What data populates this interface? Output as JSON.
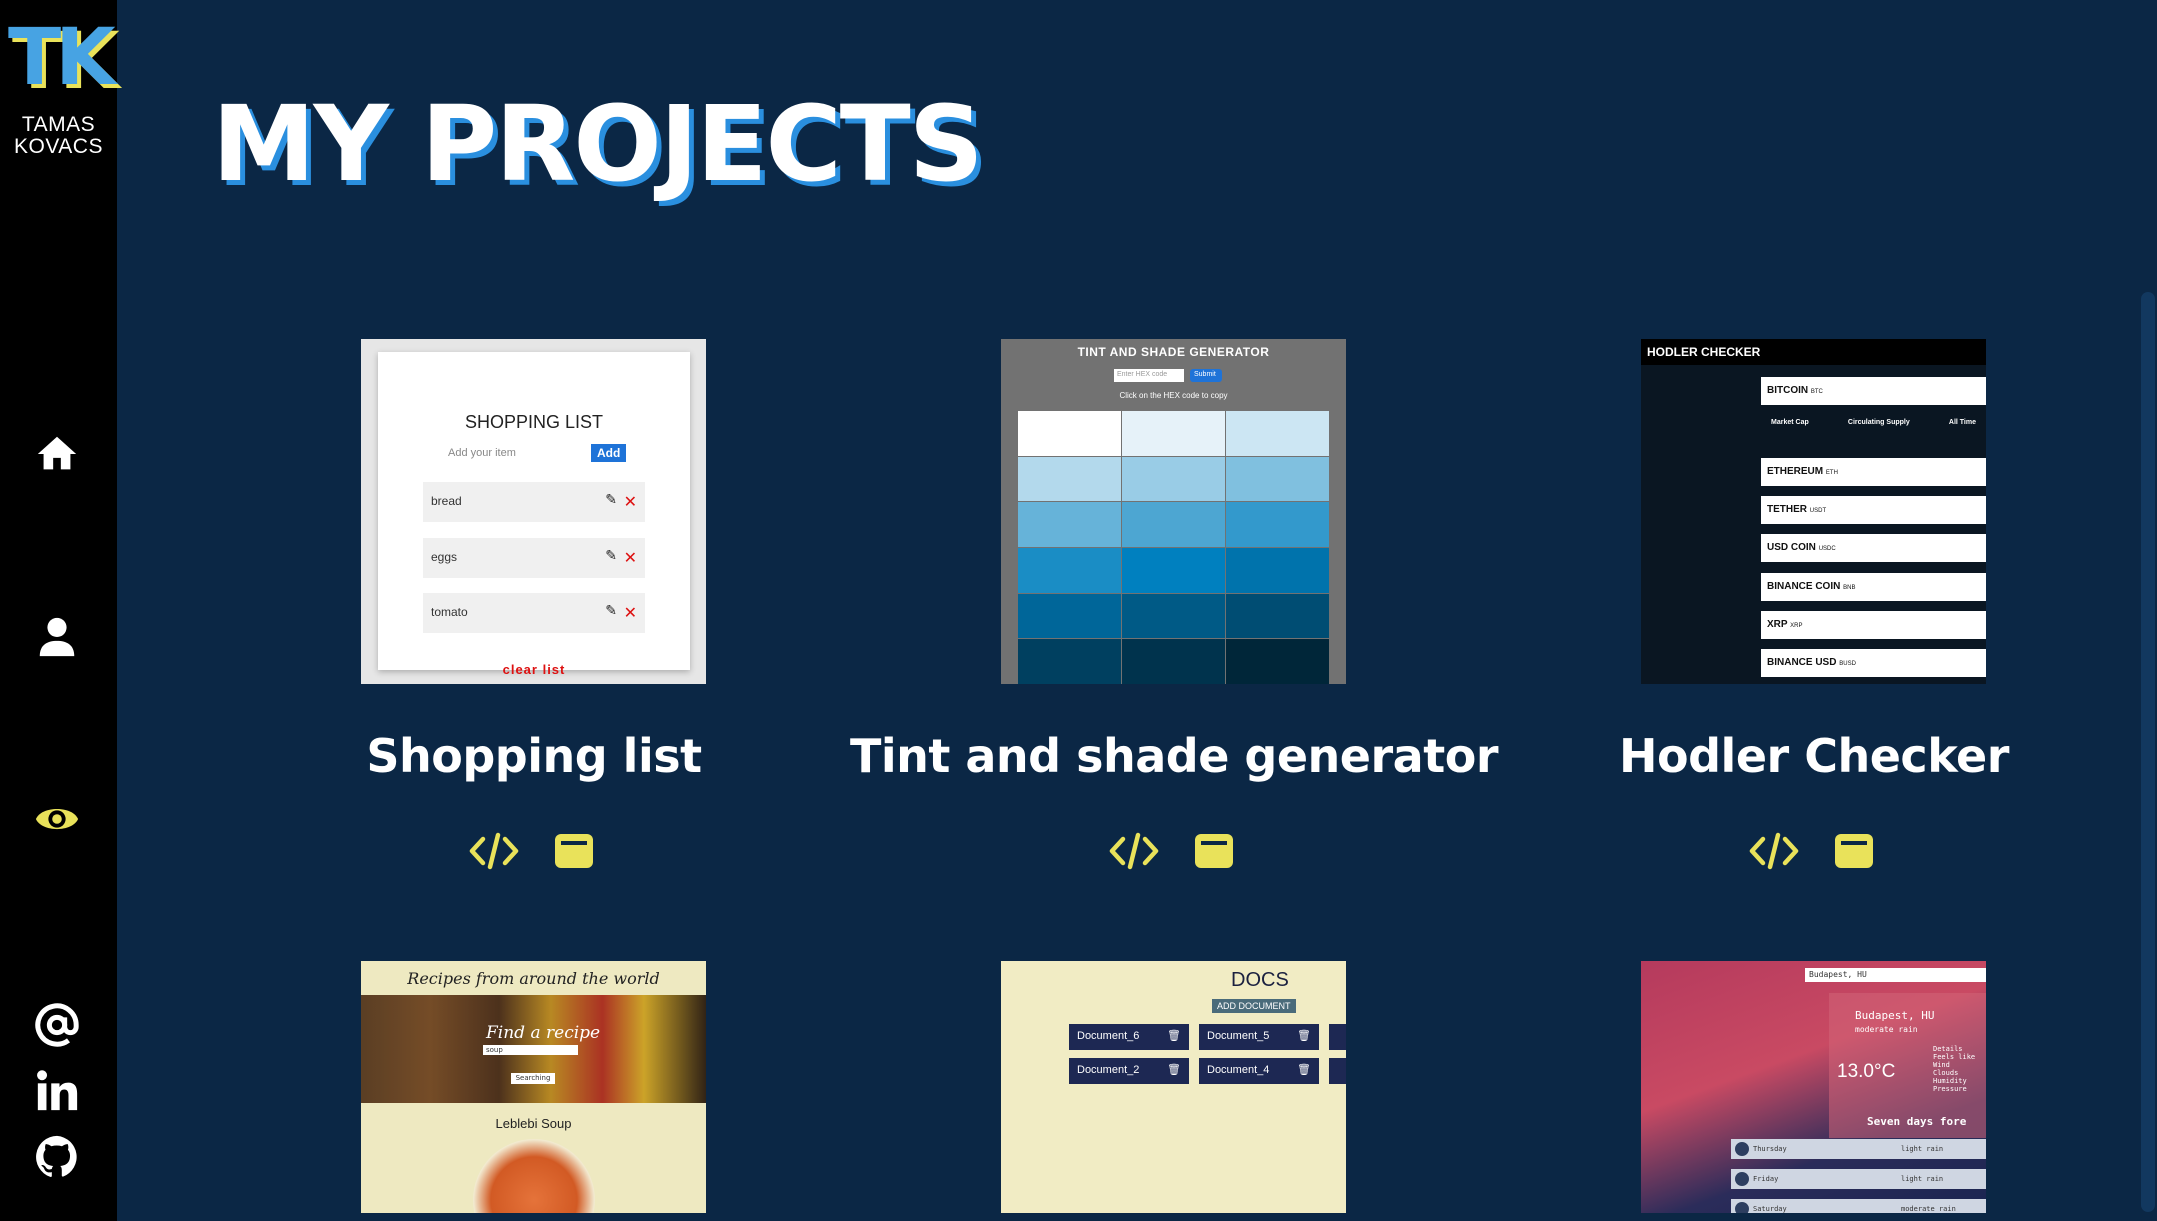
{
  "logo": {
    "mark": "TK",
    "name_line1": "TAMAS",
    "name_line2": "KOVACS"
  },
  "nav": [
    {
      "icon": "home-icon"
    },
    {
      "icon": "user-icon"
    },
    {
      "icon": "eye-icon",
      "active": true
    }
  ],
  "social": [
    {
      "icon": "at-sign-icon"
    },
    {
      "icon": "linkedin-icon"
    },
    {
      "icon": "github-icon"
    }
  ],
  "page_title": "MY PROJECTS",
  "colors": {
    "background": "#0b2745",
    "sidebar": "#000000",
    "accent": "#e9e25a",
    "title_shadow": "#2a8fdf"
  },
  "projects": [
    {
      "title": "Shopping list",
      "preview": {
        "heading": "SHOPPING LIST",
        "input_placeholder": "Add your item",
        "add_label": "Add",
        "items": [
          "bread",
          "eggs",
          "tomato"
        ],
        "clear_label": "clear list"
      }
    },
    {
      "title": "Tint and shade generator",
      "preview": {
        "heading": "TINT AND SHADE GENERATOR",
        "input_placeholder": "Enter HEX code",
        "submit_label": "Submit",
        "hint": "Click on the HEX code to copy"
      }
    },
    {
      "title": "Hodler Checker",
      "preview": {
        "heading": "HODLER CHECKER",
        "coins": [
          {
            "name": "BITCOIN",
            "ticker": "BTC"
          },
          {
            "name": "ETHEREUM",
            "ticker": "ETH"
          },
          {
            "name": "TETHER",
            "ticker": "USDT"
          },
          {
            "name": "USD COIN",
            "ticker": "USDC"
          },
          {
            "name": "BINANCE COIN",
            "ticker": "BNB"
          },
          {
            "name": "XRP",
            "ticker": "XRP"
          },
          {
            "name": "BINANCE USD",
            "ticker": "BUSD"
          }
        ],
        "stat_labels": [
          "Market Cap",
          "Circulating Supply",
          "All Time"
        ]
      }
    },
    {
      "title": "",
      "preview": {
        "heading": "Recipes from around the world",
        "search_label": "Find a recipe",
        "search_value": "soup",
        "search_button": "Searching",
        "result": "Leblebi Soup"
      }
    },
    {
      "title": "",
      "preview": {
        "heading": "DOCS",
        "add_label": "ADD DOCUMENT",
        "documents": [
          "Document_6",
          "Document_5",
          "Document_2",
          "Document_4"
        ]
      }
    },
    {
      "title": "",
      "preview": {
        "search_value": "Budapest, HU",
        "city": "Budapest, HU",
        "condition": "moderate rain",
        "temperature": "13.0°C",
        "details": [
          "Details",
          "Feels like",
          "Wind",
          "Clouds",
          "Humidity",
          "Pressure"
        ],
        "forecast_label": "Seven days fore",
        "forecast": [
          {
            "day": "Thursday",
            "desc": "light rain"
          },
          {
            "day": "Friday",
            "desc": "light rain"
          },
          {
            "day": "Saturday",
            "desc": "moderate rain"
          }
        ]
      }
    }
  ]
}
